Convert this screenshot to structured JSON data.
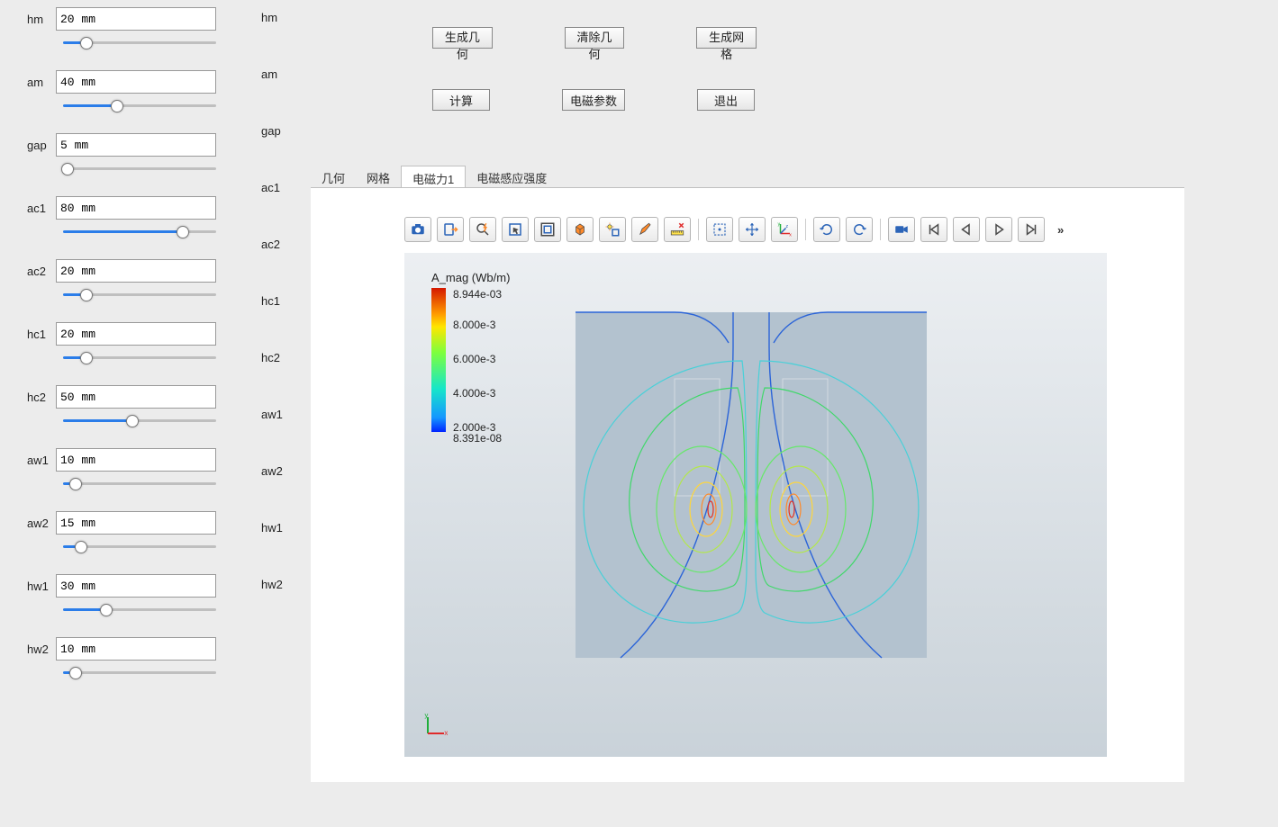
{
  "params": [
    {
      "key": "hm",
      "value": "20 mm",
      "pct": 15
    },
    {
      "key": "am",
      "value": "40 mm",
      "pct": 35
    },
    {
      "key": "gap",
      "value": "5 mm",
      "pct": 3
    },
    {
      "key": "ac1",
      "value": "80 mm",
      "pct": 78
    },
    {
      "key": "ac2",
      "value": "20 mm",
      "pct": 15
    },
    {
      "key": "hc1",
      "value": "20 mm",
      "pct": 15
    },
    {
      "key": "hc2",
      "value": "50 mm",
      "pct": 45
    },
    {
      "key": "aw1",
      "value": "10 mm",
      "pct": 8
    },
    {
      "key": "aw2",
      "value": "15 mm",
      "pct": 12
    },
    {
      "key": "hw1",
      "value": "30 mm",
      "pct": 28
    },
    {
      "key": "hw2",
      "value": "10 mm",
      "pct": 8
    }
  ],
  "actions": {
    "row1": [
      "生成几何",
      "清除几何",
      "生成网格"
    ],
    "row2": [
      "计算",
      "电磁参数",
      "退出"
    ]
  },
  "tabs": [
    "几何",
    "网格",
    "电磁力1",
    "电磁感应强度"
  ],
  "active_tab": 2,
  "toolbar_icons": [
    "camera-icon",
    "export-icon",
    "zoom-flash-icon",
    "select-window-icon",
    "fit-window-icon",
    "box-views-icon",
    "object-vis-icon",
    "brush-icon",
    "ruler-delete-icon",
    "|",
    "dashed-select-icon",
    "pan-all-icon",
    "axes-xyz-icon",
    "|",
    "rotate-ccw-icon",
    "rotate-cw-icon",
    "|",
    "video-cam-icon",
    "skip-start-icon",
    "step-back-icon",
    "play-icon",
    "step-fwd-icon"
  ],
  "more_icon": "»",
  "legend": {
    "title": "A_mag (Wb/m)",
    "max": "8.944e-03",
    "ticks": [
      {
        "label": "8.000e-3",
        "pos": 15
      },
      {
        "label": "6.000e-3",
        "pos": 53
      },
      {
        "label": "4.000e-3",
        "pos": 91
      },
      {
        "label": "2.000e-3",
        "pos": 129
      }
    ],
    "min": "8.391e-08"
  },
  "chart_data": {
    "type": "heatmap",
    "title": "A_mag (Wb/m)",
    "quantity": "A_mag",
    "unit": "Wb/m",
    "range": {
      "min": 8.391e-08,
      "max": 0.008944
    },
    "ticks": [
      0.008,
      0.006,
      0.004,
      0.002
    ],
    "description": "2D magnetic vector potential magnitude contour plot with two mirrored peak regions, contour style, jet colormap."
  }
}
